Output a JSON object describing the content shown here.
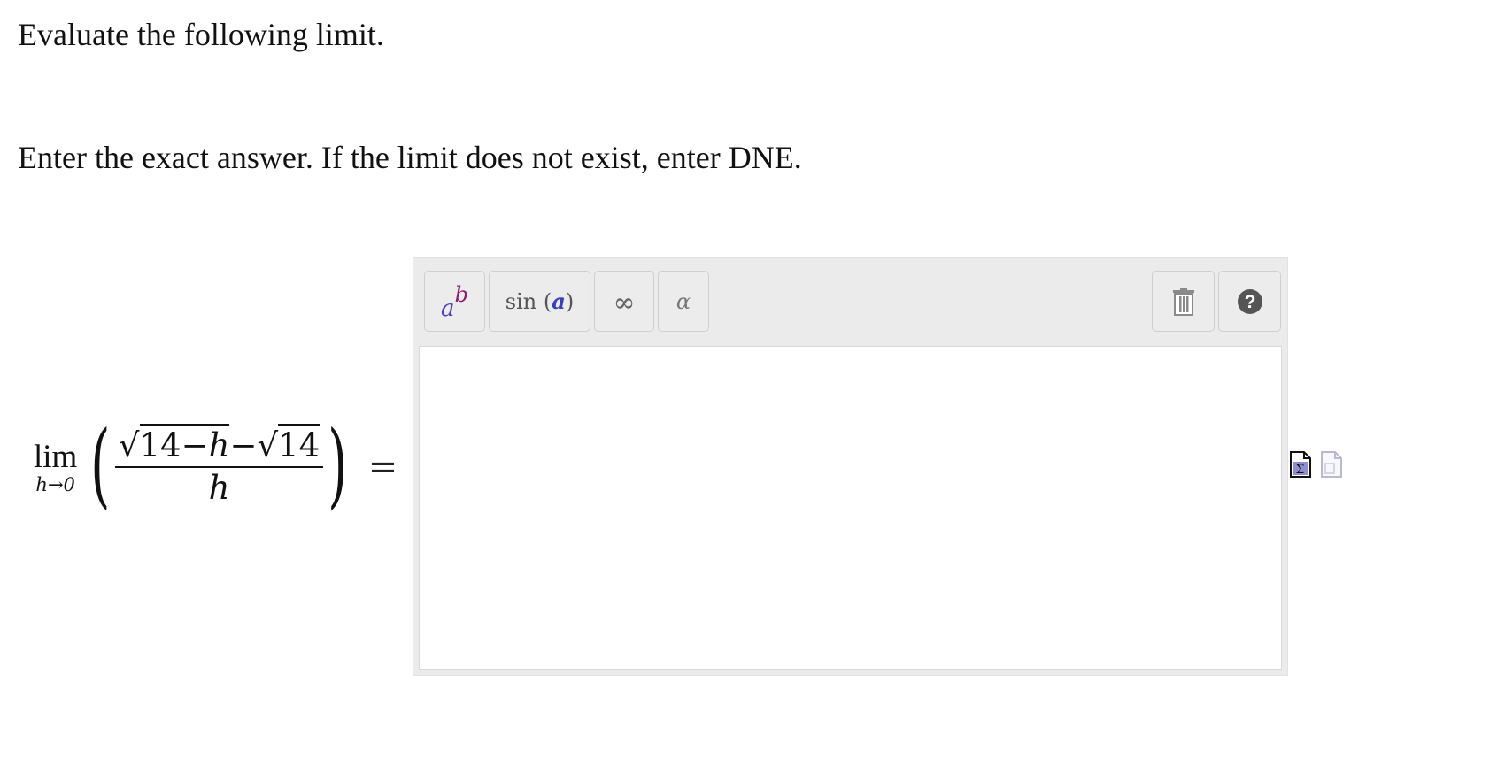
{
  "question": {
    "prompt": "Evaluate the following limit.",
    "instruction": "Enter the exact answer. If the limit does not exist, enter DNE."
  },
  "expression": {
    "lim_word": "lim",
    "lim_subscript": "h→0",
    "radicand_1": "14−",
    "radicand_1_var": "h",
    "minus": "−",
    "radicand_2": "14",
    "denominator": "h",
    "equals": "="
  },
  "editor": {
    "toolbar": {
      "power": {
        "base": "a",
        "exponent": "b"
      },
      "function": {
        "name": "sin",
        "arg": "a"
      },
      "infinity": "∞",
      "greek": "α"
    },
    "answer_value": ""
  },
  "icons": {
    "trash": "trash-icon",
    "help": "help-icon",
    "equation": "equation-editor-icon",
    "page": "page-icon"
  }
}
